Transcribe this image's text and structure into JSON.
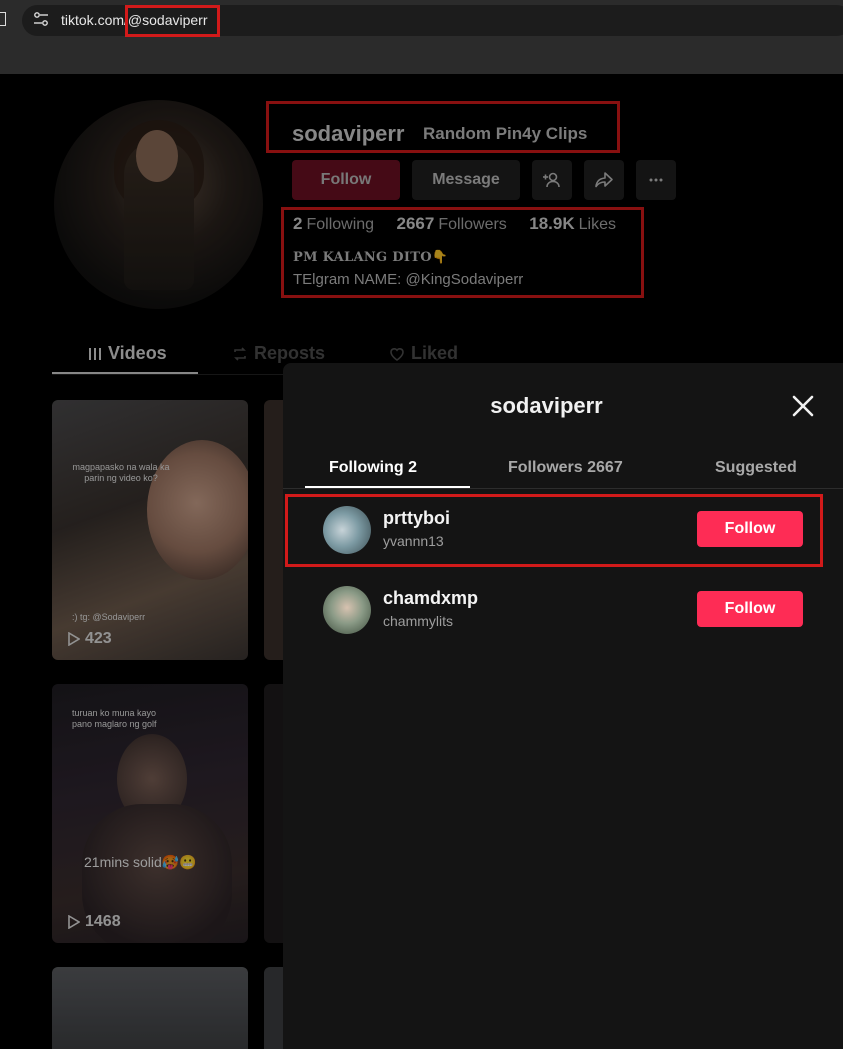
{
  "browser": {
    "url_domain": "tiktok.com",
    "url_path": "/@sodaviperr"
  },
  "profile": {
    "username": "sodaviperr",
    "nickname": "Random Pin4y Clips",
    "follow_label": "Follow",
    "message_label": "Message",
    "stats": {
      "following_count": "2",
      "following_label": "Following",
      "followers_count": "2667",
      "followers_label": "Followers",
      "likes_count": "18.9K",
      "likes_label": "Likes"
    },
    "bio_line1": "PM KALANG DITO👇",
    "bio_line2": "TElgram NAME: @KingSodaviperr"
  },
  "profile_tabs": {
    "videos": "Videos",
    "reposts": "Reposts",
    "liked": "Liked"
  },
  "videos": [
    {
      "caption": "magpapasko na wala ka parin ng video ko?",
      "bottom_text": ":) tg: @Sodaviperr",
      "views": "423"
    },
    {
      "caption": "turuan ko muna kayo pano maglaro ng golf",
      "overlay": "21mins solid🥵😬",
      "views": "1468"
    }
  ],
  "modal": {
    "title": "sodaviperr",
    "tabs": {
      "following": "Following 2",
      "followers": "Followers 2667",
      "suggested": "Suggested"
    },
    "users": [
      {
        "name": "prttyboi",
        "handle": "yvannn13",
        "button": "Follow"
      },
      {
        "name": "chamdxmp",
        "handle": "chammylits",
        "button": "Follow"
      }
    ]
  },
  "colors": {
    "accent": "#fe2c55",
    "highlight_box": "#d21a1a",
    "background": "#000000",
    "modal_bg": "#141414"
  }
}
